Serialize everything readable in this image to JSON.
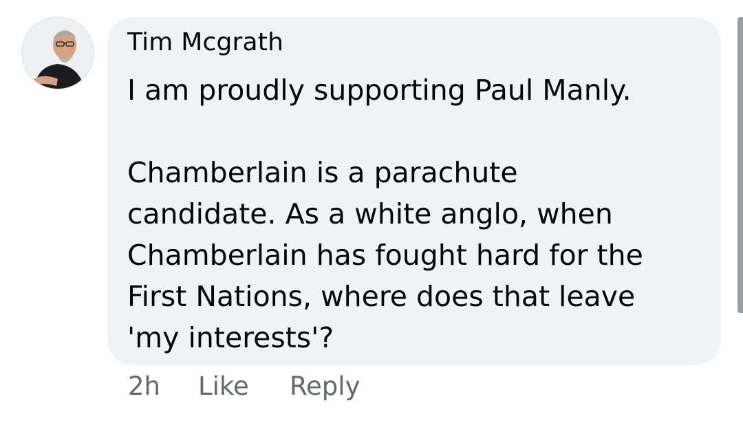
{
  "comment": {
    "author": "Tim Mcgrath",
    "lines": [
      "I am proudly supporting Paul Manly.",
      "",
      "Chamberlain is a parachute",
      "candidate. As a white anglo, when",
      "Chamberlain has fought hard for the",
      "First Nations, where does that leave",
      "'my interests'?"
    ],
    "timestamp": "2h",
    "like_label": "Like",
    "reply_label": "Reply"
  },
  "colors": {
    "bubble": "#f0f2f5",
    "text": "#050505",
    "muted": "#65676b"
  },
  "icons": {
    "avatar": "profile-photo"
  }
}
